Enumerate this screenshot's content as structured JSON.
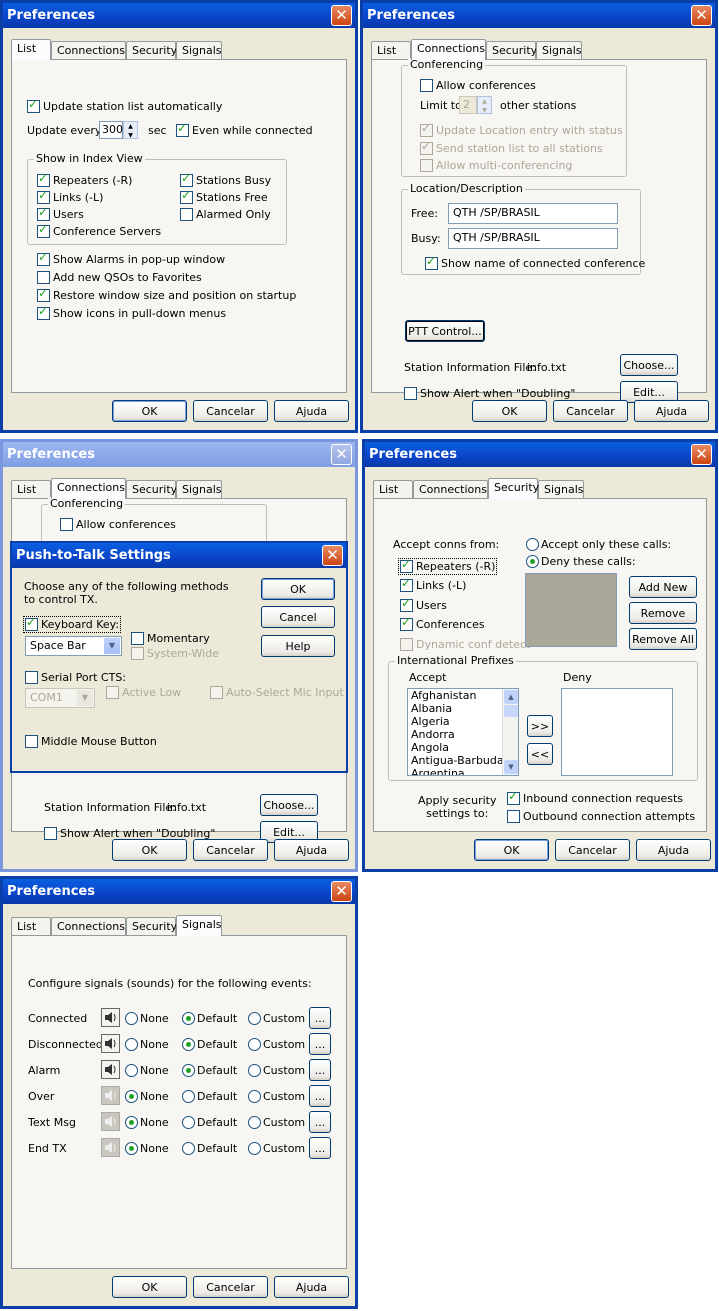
{
  "common": {
    "title": "Preferences",
    "tabs": [
      "List",
      "Connections",
      "Security",
      "Signals"
    ],
    "ok": "OK",
    "cancel": "Cancelar",
    "help": "Ajuda",
    "close_icon": "close-icon"
  },
  "list_tab": {
    "update_auto": "Update station list automatically",
    "update_every": "Update every",
    "interval": "300",
    "sec": "sec",
    "even_connected": "Even while connected",
    "index_group": "Show in Index View",
    "index_items": [
      {
        "label": "Repeaters (-R)",
        "checked": true
      },
      {
        "label": "Links (-L)",
        "checked": true
      },
      {
        "label": "Users",
        "checked": true
      },
      {
        "label": "Conference Servers",
        "checked": true
      },
      {
        "label": "Stations Busy",
        "checked": true
      },
      {
        "label": "Stations Free",
        "checked": true
      },
      {
        "label": "Alarmed Only",
        "checked": false
      }
    ],
    "options": [
      {
        "label": "Show Alarms in pop-up window",
        "checked": true
      },
      {
        "label": "Add new QSOs to Favorites",
        "checked": false
      },
      {
        "label": "Restore window size and position on startup",
        "checked": true
      },
      {
        "label": "Show icons in pull-down menus",
        "checked": true
      }
    ]
  },
  "connections_tab": {
    "conf_group": "Conferencing",
    "allow_conf": "Allow conferences",
    "limit_to": "Limit to",
    "limit_value": "2",
    "other_stations": "other stations",
    "update_location": "Update Location entry with status",
    "send_station_list": "Send station list to all stations",
    "allow_multi": "Allow multi-conferencing",
    "loc_group": "Location/Description",
    "free_label": "Free:",
    "free_value": "QTH /SP/BRASIL",
    "busy_label": "Busy:",
    "busy_value": "QTH /SP/BRASIL",
    "show_conf_name": "Show name of connected conference",
    "ptt_button": "PTT Control...",
    "station_info_label": "Station Information File:",
    "station_info_file": "info.txt",
    "choose": "Choose...",
    "show_alert": "Show Alert when \"Doubling\"",
    "edit": "Edit..."
  },
  "ptt_dialog": {
    "title": "Push-to-Talk Settings",
    "desc_line1": "Choose any of the following methods",
    "desc_line2": "to control TX.",
    "keyboard_key": "Keyboard Key:",
    "key_value": "Space Bar",
    "momentary": "Momentary",
    "system_wide": "System-Wide",
    "serial_cts": "Serial Port CTS:",
    "com_value": "COM1",
    "active_low": "Active Low",
    "auto_select": "Auto-Select Mic Input",
    "middle_mouse": "Middle Mouse Button",
    "ok": "OK",
    "cancel": "Cancel",
    "help": "Help"
  },
  "security_tab": {
    "accept_from": "Accept conns from:",
    "accept_items": [
      {
        "label": "Repeaters (-R)",
        "checked": true
      },
      {
        "label": "Links (-L)",
        "checked": true
      },
      {
        "label": "Users",
        "checked": true
      },
      {
        "label": "Conferences",
        "checked": true
      }
    ],
    "dynamic_conf": "Dynamic conf detect",
    "accept_only": "Accept only these calls:",
    "deny_these": "Deny these calls:",
    "add_new": "Add New",
    "remove": "Remove",
    "remove_all": "Remove All",
    "intl_group": "International Prefixes",
    "accept_col": "Accept",
    "deny_col": "Deny",
    "countries": [
      "Afghanistan",
      "Albania",
      "Algeria",
      "Andorra",
      "Angola",
      "Antigua-Barbuda",
      "Argentina"
    ],
    "move_right": ">>",
    "move_left": "<<",
    "apply_line1": "Apply security",
    "apply_line2": "settings to:",
    "inbound": "Inbound connection requests",
    "outbound": "Outbound connection attempts"
  },
  "signals_tab": {
    "intro": "Configure signals (sounds) for the following events:",
    "none": "None",
    "default": "Default",
    "custom": "Custom",
    "browse": "...",
    "events": [
      {
        "label": "Connected",
        "selected": "Default"
      },
      {
        "label": "Disconnected",
        "selected": "Default"
      },
      {
        "label": "Alarm",
        "selected": "Default"
      },
      {
        "label": "Over",
        "selected": "None"
      },
      {
        "label": "Text Msg",
        "selected": "None"
      },
      {
        "label": "End TX",
        "selected": "None"
      }
    ]
  }
}
